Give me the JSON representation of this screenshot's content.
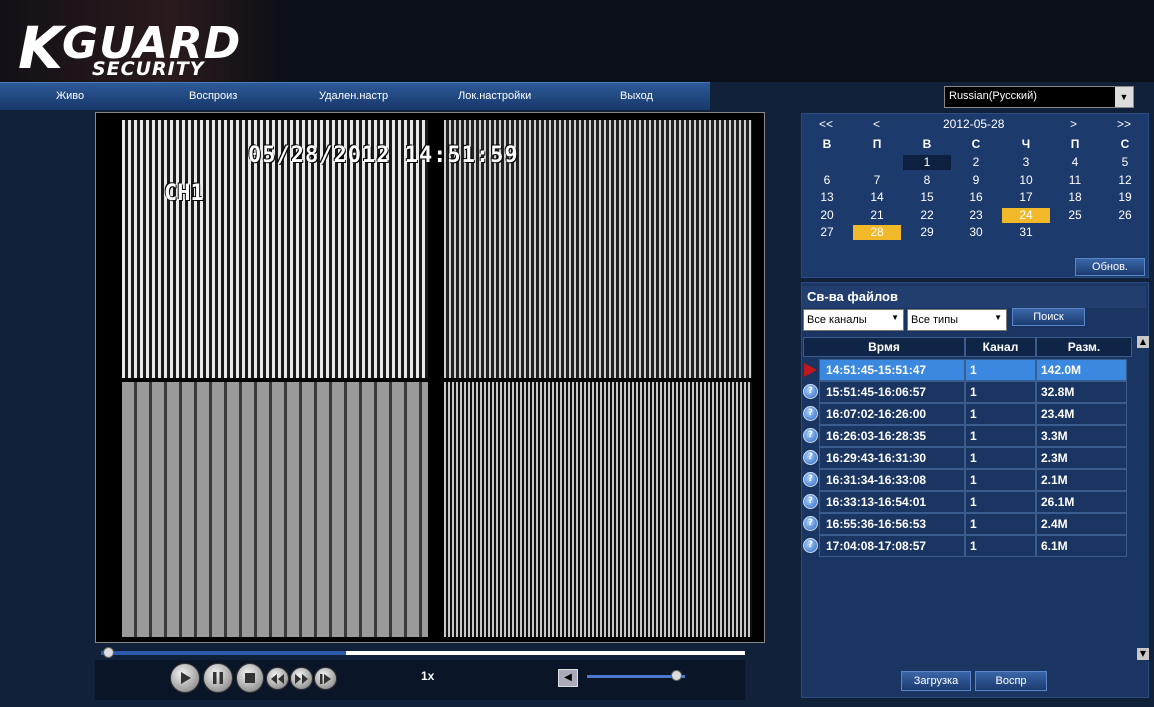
{
  "logo": {
    "k": "K",
    "guard": "GUARD",
    "security": "SECURITY"
  },
  "nav": [
    "Живо",
    "Воспроиз",
    "Удален.настр",
    "Лок.настройки",
    "Выход"
  ],
  "language": {
    "selected": "Russian(Русский)"
  },
  "video": {
    "osd_time": "05/28/2012 14:51:59",
    "osd_channel": "CH1"
  },
  "playback": {
    "speed": "1x",
    "progress": 0.38,
    "volume": 0.92
  },
  "calendar": {
    "prev_year": "<<",
    "prev_month": "<",
    "title": "2012-05-28",
    "next_month": ">",
    "next_year": ">>",
    "weekdays": [
      "В",
      "П",
      "В",
      "С",
      "Ч",
      "П",
      "С"
    ],
    "weeks": [
      [
        "",
        "",
        "1",
        "2",
        "3",
        "4",
        "5"
      ],
      [
        "6",
        "7",
        "8",
        "9",
        "10",
        "11",
        "12"
      ],
      [
        "13",
        "14",
        "15",
        "16",
        "17",
        "18",
        "19"
      ],
      [
        "20",
        "21",
        "22",
        "23",
        "24",
        "25",
        "26"
      ],
      [
        "27",
        "28",
        "29",
        "30",
        "31",
        "",
        ""
      ]
    ],
    "highlight_color": "#f1b92a",
    "refresh_label": "Обнов."
  },
  "files": {
    "title": "Св-ва файлов",
    "channel_filter": "Все каналы",
    "type_filter": "Все типы",
    "search_label": "Поиск",
    "columns": [
      "Врмя",
      "Канал",
      "Разм."
    ],
    "rows": [
      {
        "time": "14:51:45-15:51:47",
        "channel": "1",
        "size": "142.0M"
      },
      {
        "time": "15:51:45-16:06:57",
        "channel": "1",
        "size": "32.8M"
      },
      {
        "time": "16:07:02-16:26:00",
        "channel": "1",
        "size": "23.4M"
      },
      {
        "time": "16:26:03-16:28:35",
        "channel": "1",
        "size": "3.3M"
      },
      {
        "time": "16:29:43-16:31:30",
        "channel": "1",
        "size": "2.3M"
      },
      {
        "time": "16:31:34-16:33:08",
        "channel": "1",
        "size": "2.1M"
      },
      {
        "time": "16:33:13-16:54:01",
        "channel": "1",
        "size": "26.1M"
      },
      {
        "time": "16:55:36-16:56:53",
        "channel": "1",
        "size": "2.4M"
      },
      {
        "time": "17:04:08-17:08:57",
        "channel": "1",
        "size": "6.1M"
      }
    ],
    "download_label": "Загрузка",
    "play_label": "Воспр"
  },
  "colors": {
    "accent": "#2a5aa8",
    "selected_row": "#3b88e0",
    "background": "#11213a"
  }
}
